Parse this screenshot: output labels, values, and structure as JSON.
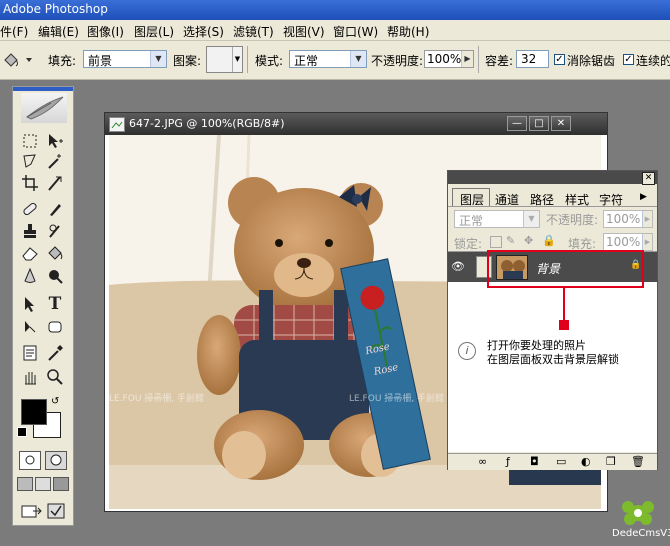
{
  "app": {
    "title": "Adobe Photoshop"
  },
  "menu": [
    "件(F)",
    "编辑(E)",
    "图像(I)",
    "图层(L)",
    "选择(S)",
    "滤镜(T)",
    "视图(V)",
    "窗口(W)",
    "帮助(H)"
  ],
  "options": {
    "fill_label": "填充:",
    "fill_value": "前景",
    "pattern_label": "图案:",
    "mode_label": "模式:",
    "mode_value": "正常",
    "opacity_label": "不透明度:",
    "opacity_value": "100%",
    "tolerance_label": "容差:",
    "tolerance_value": "32",
    "antialias_label": "消除锯齿",
    "contiguous_label": "连续的"
  },
  "document": {
    "title": "647-2.JPG @ 100%(RGB/8#)"
  },
  "photo": {
    "box_text_1": "Rose",
    "box_text_2": "Rose",
    "watermark": "LE.FOU  掃帚柵, 手創館"
  },
  "layers_panel": {
    "tabs": [
      "图层",
      "通道",
      "路径",
      "样式",
      "字符"
    ],
    "blend_value": "正常",
    "opacity_label": "不透明度:",
    "opacity_value": "100%",
    "lock_label": "锁定:",
    "fill_label": "填充:",
    "fill_value": "100%",
    "layer_name": "背景"
  },
  "annotation": {
    "line1": "打开你要处理的照片",
    "line2": "在图层面板双击背景层解锁"
  },
  "logo": {
    "text": "DedeCmsV3"
  },
  "colors": {
    "title_bar": "#2b5fc8",
    "highlight": "#e0001b",
    "ui_bg": "#ece9d8"
  }
}
